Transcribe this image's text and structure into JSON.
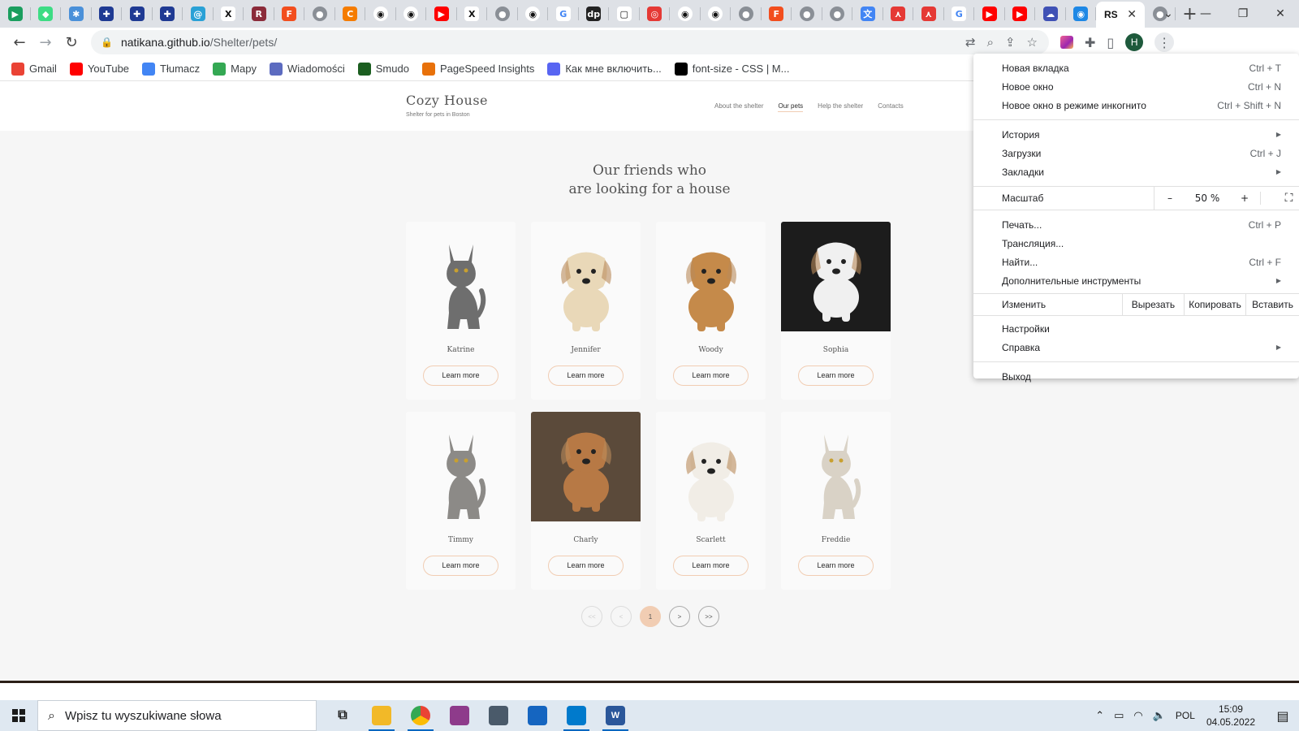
{
  "tabs": {
    "icons": [
      "play-icon",
      "android-icon",
      "snowflake-icon",
      "uk-flag-icon",
      "uk-flag-icon",
      "uk-flag-icon",
      "at-icon",
      "x-icon",
      "reader-icon",
      "figma-icon",
      "globe-icon",
      "c-icon",
      "github-icon",
      "github-icon",
      "youtube-icon",
      "x-icon",
      "globe-icon",
      "github-icon",
      "google-icon",
      "dp-icon",
      "chat-icon",
      "pdf-icon",
      "github-icon",
      "github-icon",
      "globe-icon",
      "figma-icon",
      "globe-icon",
      "globe-icon",
      "translate-icon",
      "acrobat-icon",
      "acrobat-icon",
      "google-icon",
      "youtube-icon",
      "youtube-icon",
      "cloud-icon",
      "chrome-icon"
    ],
    "active_label": "RS",
    "close_glyph": "✕",
    "after_active_icon": "globe-icon",
    "new_tab_glyph": "+"
  },
  "window_controls": {
    "dropdown": "⌄",
    "minimize": "—",
    "restore": "❐",
    "close": "✕"
  },
  "toolbar": {
    "back": "←",
    "forward": "→",
    "reload": "↻",
    "url_host": "natikana.github.io",
    "url_path": "/Shelter/pets/",
    "profile_initial": "H",
    "menu_glyph": "⋮"
  },
  "bookmarks": [
    {
      "label": "Gmail",
      "color": "#ea4335"
    },
    {
      "label": "YouTube",
      "color": "#ff0000"
    },
    {
      "label": "Tłumacz",
      "color": "#4285f4"
    },
    {
      "label": "Mapy",
      "color": "#34a853"
    },
    {
      "label": "Wiadomości",
      "color": "#5c6bc0"
    },
    {
      "label": "Smudo",
      "color": "#1b5e20"
    },
    {
      "label": "PageSpeed Insights",
      "color": "#e8710a"
    },
    {
      "label": "Как мне включить...",
      "color": "#5865f2"
    },
    {
      "label": "font-size - CSS | M...",
      "color": "#000000"
    }
  ],
  "site": {
    "logo_title": "Cozy House",
    "logo_subtitle": "Shelter for pets in Boston",
    "nav": [
      "About the shelter",
      "Our pets",
      "Help the shelter",
      "Contacts"
    ],
    "active_nav": "Our pets",
    "section_title_line1": "Our friends who",
    "section_title_line2": "are looking for a house",
    "button_label": "Learn more",
    "pets": [
      {
        "name": "Katrine",
        "animal": "cat",
        "photo_bg": "#fafafa",
        "fur": "#6e6e6e"
      },
      {
        "name": "Jennifer",
        "animal": "dog",
        "photo_bg": "#fafafa",
        "fur": "#e9d8b8"
      },
      {
        "name": "Woody",
        "animal": "dog",
        "photo_bg": "#fafafa",
        "fur": "#c58a4a"
      },
      {
        "name": "Sophia",
        "animal": "dog",
        "photo_bg": "#1c1c1c",
        "fur": "#f0f0f0"
      },
      {
        "name": "Timmy",
        "animal": "cat",
        "photo_bg": "#fafafa",
        "fur": "#8c8a87"
      },
      {
        "name": "Charly",
        "animal": "dog",
        "photo_bg": "#5b4a3a",
        "fur": "#b77945"
      },
      {
        "name": "Scarlett",
        "animal": "dog",
        "photo_bg": "#fafafa",
        "fur": "#f1ede6"
      },
      {
        "name": "Freddie",
        "animal": "cat",
        "photo_bg": "#fafafa",
        "fur": "#d9d2c6"
      }
    ],
    "pagination": [
      "<<",
      "<",
      "1",
      ">",
      ">>"
    ],
    "current_page": "1"
  },
  "menu": {
    "new_tab": "Новая вкладка",
    "new_tab_sc": "Ctrl + T",
    "new_window": "Новое окно",
    "new_window_sc": "Ctrl + N",
    "incognito": "Новое окно в режиме инкогнито",
    "incognito_sc": "Ctrl + Shift + N",
    "history": "История",
    "downloads": "Загрузки",
    "downloads_sc": "Ctrl + J",
    "bookmarks": "Закладки",
    "zoom_label": "Масштаб",
    "zoom_minus": "–",
    "zoom_value": "50 %",
    "zoom_plus": "+",
    "fullscreen": "⛶",
    "print": "Печать...",
    "print_sc": "Ctrl + P",
    "cast": "Трансляция...",
    "find": "Найти...",
    "find_sc": "Ctrl + F",
    "more_tools": "Дополнительные инструменты",
    "edit_label": "Изменить",
    "cut": "Вырезать",
    "copy": "Копировать",
    "paste": "Вставить",
    "settings": "Настройки",
    "help": "Справка",
    "exit": "Выход",
    "submenu_arrow": "▶"
  },
  "taskbar": {
    "search_placeholder": "Wpisz tu wyszukiwane słowa",
    "apps": [
      {
        "icon": "task-view-icon",
        "color": "#dfe8f1",
        "glyph": "⧉",
        "running": false
      },
      {
        "icon": "file-explorer-icon",
        "color": "#f2b928",
        "glyph": "",
        "running": true
      },
      {
        "icon": "chrome-icon",
        "color": "#ffffff",
        "glyph": "",
        "running": true
      },
      {
        "icon": "winrar-icon",
        "color": "#8e3b8b",
        "glyph": "",
        "running": false
      },
      {
        "icon": "calculator-icon",
        "color": "#4a5a6a",
        "glyph": "",
        "running": false
      },
      {
        "icon": "save-icon",
        "color": "#1565c0",
        "glyph": "",
        "running": false
      },
      {
        "icon": "vscode-icon",
        "color": "#007acc",
        "glyph": "",
        "running": true
      },
      {
        "icon": "word-icon",
        "color": "#2b579a",
        "glyph": "W",
        "running": true
      }
    ],
    "language": "POL",
    "time": "15:09",
    "date": "04.05.2022"
  }
}
